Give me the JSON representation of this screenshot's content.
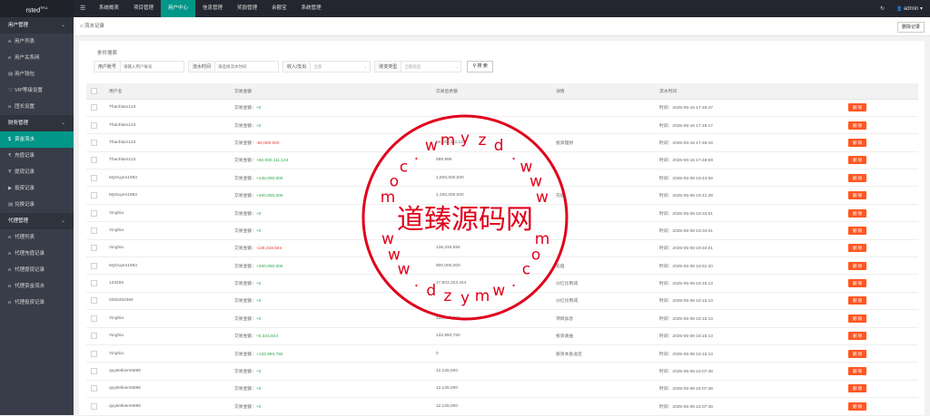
{
  "app": {
    "logo_text": "rsted",
    "logo_sup": "TPL1",
    "menu_toggle": "☰"
  },
  "topnav": [
    {
      "label": "系统概表"
    },
    {
      "label": "项目管理"
    },
    {
      "label": "用户中心",
      "active": true
    },
    {
      "label": "信息管理"
    },
    {
      "label": "奖励管理"
    },
    {
      "label": "余额宝"
    },
    {
      "label": "系统管理"
    }
  ],
  "topright": {
    "refresh_icon": "↻",
    "user_icon": "👤",
    "username": "admin",
    "caret": "▾"
  },
  "sidebar": {
    "groups": [
      {
        "label": "用户管理",
        "items": [
          {
            "icon": "ጰ",
            "label": "用户列表"
          },
          {
            "icon": "ጰ",
            "label": "用户关系网"
          },
          {
            "icon": "▤",
            "label": "用户钱包"
          },
          {
            "icon": "♡",
            "label": "VIP等级设置"
          },
          {
            "icon": "ጰ",
            "label": "团长设置"
          }
        ]
      },
      {
        "label": "财务管理",
        "items": [
          {
            "icon": "$",
            "label": "资金流水",
            "active": true
          },
          {
            "icon": "₹",
            "label": "充值记录"
          },
          {
            "icon": "₹",
            "label": "提现记录"
          },
          {
            "icon": "▶",
            "label": "投资记录"
          },
          {
            "icon": "▤",
            "label": "兑换记录"
          }
        ]
      },
      {
        "label": "代理管理",
        "items": [
          {
            "icon": "ጰ",
            "label": "代理列表"
          },
          {
            "icon": "ጰ",
            "label": "代理充值记录"
          },
          {
            "icon": "ጰ",
            "label": "代理提现记录"
          },
          {
            "icon": "ጰ",
            "label": "代理资金流水"
          },
          {
            "icon": "ጰ",
            "label": "代理投资记录"
          }
        ]
      }
    ],
    "chevron": "⌄"
  },
  "breadcrumb": {
    "home_icon": "⌂",
    "text": "流水记录",
    "right_button": "删除记录"
  },
  "filter": {
    "title": "条件搜索",
    "user_label": "用户账号",
    "user_placeholder": "请输入用户账号",
    "time_label": "流水时间",
    "time_placeholder": "请选择流水时间",
    "inout_label": "收入/支出",
    "inout_value": "全部",
    "type_label": "账变类型",
    "type_value": "全部类型",
    "search_button": "搜 索",
    "search_icon": "⚲"
  },
  "table": {
    "headers": [
      "用户名",
      "交易金额",
      "交易后余额",
      "详情",
      "流水时间",
      ""
    ],
    "amount_prefix": "交易金额：",
    "time_prefix": "时间：",
    "delete_label": "删 除",
    "rows": [
      {
        "user": "Thanhlam123",
        "amount": "+0",
        "sign": "pos",
        "balance": "",
        "detail": "",
        "time": "2025-06-16 17:49:47"
      },
      {
        "user": "Thanhlam123",
        "amount": "+0",
        "sign": "pos",
        "balance": "",
        "detail": "",
        "time": "2025-06-16 17:49:17"
      },
      {
        "user": "Thanhlam123",
        "amount": "-50,000,000",
        "sign": "neg",
        "balance": "50,001,111,123",
        "detail": "投资理财",
        "time": "2025-06-16 17:49:16"
      },
      {
        "user": "Thanhlam123",
        "amount": "+50,000,111,124",
        "sign": "pos",
        "balance": "999,999",
        "detail": "",
        "time": "2025-06-16 17:48:59"
      },
      {
        "user": "MyDuyen1983",
        "amount": "+148,000,000",
        "sign": "pos",
        "balance": "1,500,000,000",
        "detail": "",
        "time": "2025-05-08 19:44:59"
      },
      {
        "user": "MyDuyen1983",
        "amount": "+400,000,000",
        "sign": "pos",
        "balance": "1,100,000,000",
        "detail": "充值",
        "time": "2025-05-08 19:41:39"
      },
      {
        "user": "Vinghia",
        "amount": "+0",
        "sign": "pos",
        "balance": "",
        "detail": "",
        "time": "2025-05-08 19:34:01"
      },
      {
        "user": "Vinghia",
        "amount": "+0",
        "sign": "pos",
        "balance": "",
        "detail": "",
        "time": "2025-05-08 19:34:01"
      },
      {
        "user": "Vinghia",
        "amount": "-136,318,594",
        "sign": "neg",
        "balance": "136,318,594",
        "detail": "",
        "time": "2025-05-08 19:34:01"
      },
      {
        "user": "MyDuyen1983",
        "amount": "+200,000,000",
        "sign": "pos",
        "balance": "900,000,000",
        "detail": "充值",
        "time": "2025-05-08 18:51:20"
      },
      {
        "user": "123456",
        "amount": "+0",
        "sign": "pos",
        "balance": "17,603,323,444",
        "detail": "分红比例减",
        "time": "2025-05-08 18:15:13"
      },
      {
        "user": "0283482384",
        "amount": "+0",
        "sign": "pos",
        "balance": "",
        "detail": "分红比例减",
        "time": "2025-05-08 18:15:13"
      },
      {
        "user": "Vinghia",
        "amount": "+0",
        "sign": "pos",
        "balance": "132,993,750",
        "detail": "项目加息",
        "time": "2025-05-08 18:15:13"
      },
      {
        "user": "Vinghia",
        "amount": "+5,324,844",
        "sign": "pos",
        "balance": "132,993,750",
        "detail": "投资收益",
        "time": "2025-05-08 18:15:13"
      },
      {
        "user": "Vinghia",
        "amount": "+132,993,750",
        "sign": "pos",
        "balance": "0",
        "detail": "投资本金返还",
        "time": "2025-05-08 18:15:13"
      },
      {
        "user": "quytietkiem6886",
        "amount": "+0",
        "sign": "pos",
        "balance": "12,125,000",
        "detail": "",
        "time": "2025-05-08 16:07:48"
      },
      {
        "user": "quytietkiem6886",
        "amount": "+0",
        "sign": "pos",
        "balance": "12,125,000",
        "detail": "",
        "time": "2025-05-08 16:07:48"
      },
      {
        "user": "quytietkiem6886",
        "amount": "+0",
        "sign": "pos",
        "balance": "12,125,000",
        "detail": "",
        "time": "2025-05-08 16:07:48"
      }
    ]
  },
  "watermark": {
    "center_text": "道臻源码网",
    "top_letters": [
      "w",
      "w",
      "w",
      ".",
      "d",
      "z",
      "y",
      "m",
      "w",
      ".",
      "c",
      "o",
      "m"
    ],
    "bottom_letters": [
      "w",
      "w",
      "w",
      ".",
      "d",
      "z",
      "y",
      "m",
      "w",
      ".",
      "c",
      "o",
      "m"
    ],
    "color": "#e0001b"
  }
}
